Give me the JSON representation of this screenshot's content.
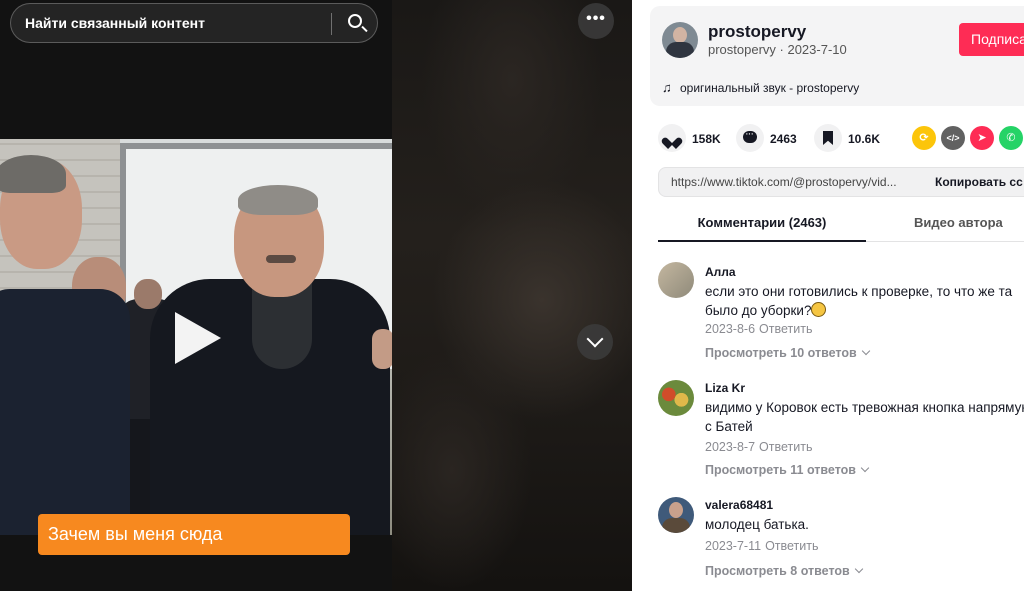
{
  "search": {
    "text": "Найти связанный контент"
  },
  "player": {
    "more_label": "•••",
    "subtitle": "Зачем вы меня сюда"
  },
  "author": {
    "username": "prostopervy",
    "subline": "prostopervy · 2023-7-10",
    "follow_label": "Подписа",
    "music": "оригинальный звук - prostopervy"
  },
  "stats": {
    "likes": "158K",
    "comments": "2463",
    "saves": "10.6K"
  },
  "share_icons": [
    "repost-icon",
    "embed-icon",
    "send-icon",
    "whatsapp-icon"
  ],
  "link": {
    "url": "https://www.tiktok.com/@prostopervy/vid...",
    "copy_label": "Копировать сс"
  },
  "tabs": {
    "comments": "Комментарии (2463)",
    "author_videos": "Видео автора"
  },
  "comments": [
    {
      "name": "Алла",
      "text": "если это они готовились к проверке, то что же та было до уборки?",
      "date": "2023-8-6",
      "reply": "Ответить",
      "replies": "Просмотреть 10 ответов"
    },
    {
      "name": "Liza Kr",
      "text": "видимо у Коровок есть тревожная кнопка напрямую с Батей",
      "date": "2023-8-7",
      "reply": "Ответить",
      "replies": "Просмотреть 11 ответов"
    },
    {
      "name": "valera68481",
      "text": "молодец батька.",
      "date": "2023-7-11",
      "reply": "Ответить",
      "replies": "Просмотреть 8 ответов"
    }
  ],
  "colors": {
    "accent": "#fe2c55",
    "subtitle_bg": "#f7891f",
    "repost": "#fcc50a",
    "whatsapp": "#25d366"
  }
}
